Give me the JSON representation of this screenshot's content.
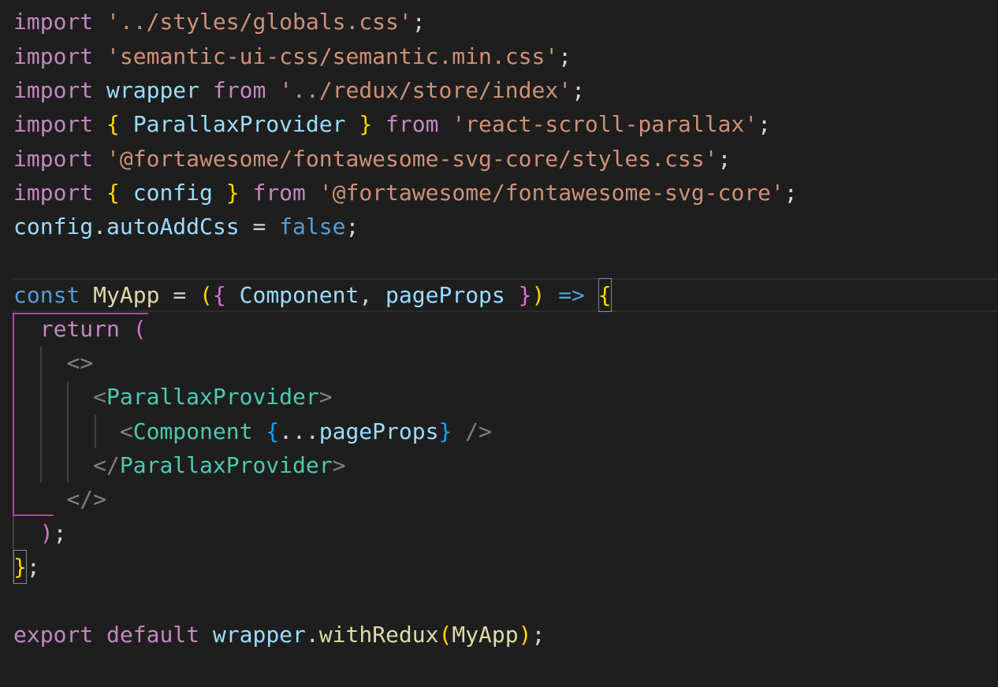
{
  "editor": {
    "theme": {
      "background": "#1e1e1e",
      "keyword_control": "#c586c0",
      "keyword_storage": "#569cd6",
      "string": "#ce9178",
      "variable": "#9cdcfe",
      "constant": "#4fc1ff",
      "function": "#dcdcaa",
      "jsx_tag": "#4ec9b0",
      "bracket_gold": "#ffd700",
      "bracket_blue": "#179fff",
      "indent_guide_active": "#a64ca6"
    },
    "tokens": {
      "import": "import",
      "from": "from",
      "const": "const",
      "return": "return",
      "export": "export",
      "default": "default",
      "false": "false",
      "wrapper": "wrapper",
      "parallax_provider": "ParallaxProvider",
      "config": "config",
      "auto_add_css": "autoAddCss",
      "my_app": "MyApp",
      "component": "Component",
      "page_props": "pageProps",
      "with_redux": "withRedux",
      "spread": "...",
      "arrow": "=>",
      "str_globals": "'../styles/globals.css'",
      "str_semantic": "'semantic-ui-css/semantic.min.css'",
      "str_store": "'../redux/store/index'",
      "str_parallax": "'react-scroll-parallax'",
      "str_fa_styles": "'@fortawesome/fontawesome-svg-core/styles.css'",
      "str_fa_core": "'@fortawesome/fontawesome-svg-core'"
    }
  }
}
